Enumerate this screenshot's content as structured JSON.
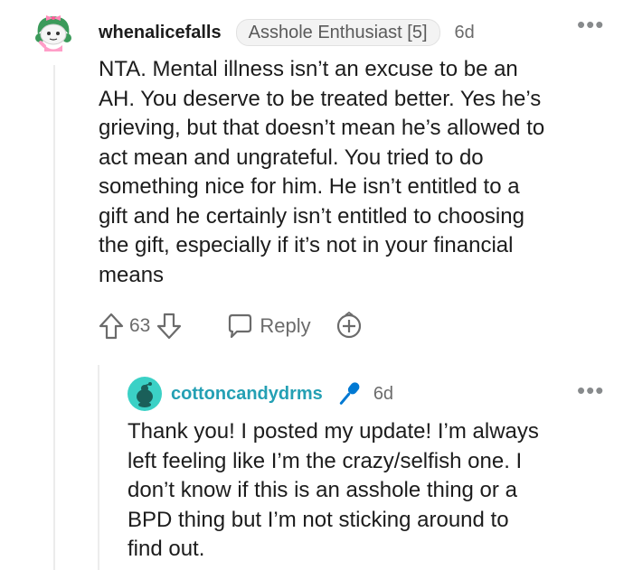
{
  "main_comment": {
    "username": "whenalicefalls",
    "flair": "Asshole Enthusiast [5]",
    "timestamp": "6d",
    "body": "NTA. Mental illness isn’t an excuse to be an\nAH. You deserve to be treated better. Yes he’s\ngrieving, but that doesn’t mean he’s allowed to\nact mean and ungrateful. You tried to do\nsomething nice for him. He isn’t entitled to a\ngift and he certainly isn’t entitled to choosing\nthe gift, especially if it’s not in your financial\nmeans",
    "score": "63",
    "reply_label": "Reply",
    "icons": {
      "avatar": "snoo-avatar-icon",
      "upvote": "upvote-arrow-icon",
      "downvote": "downvote-arrow-icon",
      "reply": "speech-bubble-icon",
      "award": "award-plus-icon",
      "more": "more-dots-icon"
    }
  },
  "reply_comment": {
    "username": "cottoncandydrms",
    "timestamp": "6d",
    "body": "Thank you! I posted my update! I’m always\nleft feeling like I’m the crazy/selfish one. I\ndon’t know if this is an asshole thing or a\nBPD thing but I’m not sticking around to\nfind out.",
    "icons": {
      "avatar": "snoo-avatar-icon",
      "op_badge": "microphone-icon",
      "more": "more-dots-icon"
    }
  },
  "more_glyph": "•••",
  "colors": {
    "text": "#1c1c1c",
    "meta": "#6b6b6b",
    "reply_username": "#24a0b4",
    "mic": "#0079d3",
    "avatar_teal": "#3bd1c6"
  }
}
